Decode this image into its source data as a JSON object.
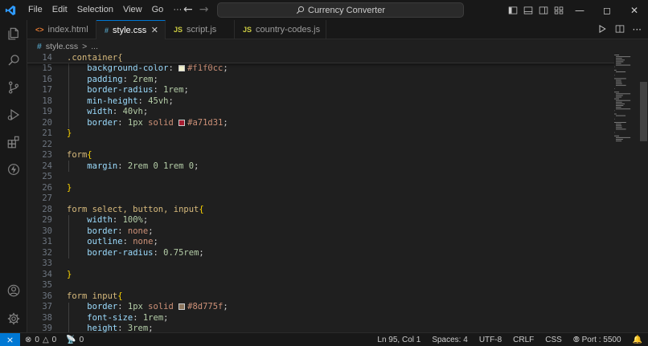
{
  "menu": [
    "File",
    "Edit",
    "Selection",
    "View",
    "Go",
    "···"
  ],
  "search": {
    "label": "Currency Converter"
  },
  "tabs": [
    {
      "label": "index.html",
      "icon": "<>",
      "color": "#e37933"
    },
    {
      "label": "style.css",
      "icon": "#",
      "color": "#519aba"
    },
    {
      "label": "script.js",
      "icon": "JS",
      "color": "#cbcb41"
    },
    {
      "label": "country-codes.js",
      "icon": "JS",
      "color": "#cbcb41"
    }
  ],
  "breadcrumb": {
    "icon": "#",
    "file": "style.css",
    "separator": ">",
    "more": "..."
  },
  "sticky": {
    "number": "14",
    "text": ".container{"
  },
  "code_lines": [
    {
      "n": "15",
      "tokens": [
        {
          "t": "    ",
          "c": ""
        },
        {
          "t": "background-color",
          "c": "prop"
        },
        {
          "t": ": ",
          "c": ""
        },
        {
          "swatch": "#f1f0cc"
        },
        {
          "t": "#f1f0cc",
          "c": "val"
        },
        {
          "t": ";",
          "c": ""
        }
      ]
    },
    {
      "n": "16",
      "tokens": [
        {
          "t": "    ",
          "c": ""
        },
        {
          "t": "padding",
          "c": "prop"
        },
        {
          "t": ": ",
          "c": ""
        },
        {
          "t": "2rem",
          "c": "num"
        },
        {
          "t": ";",
          "c": ""
        }
      ]
    },
    {
      "n": "17",
      "tokens": [
        {
          "t": "    ",
          "c": ""
        },
        {
          "t": "border-radius",
          "c": "prop"
        },
        {
          "t": ": ",
          "c": ""
        },
        {
          "t": "1rem",
          "c": "num"
        },
        {
          "t": ";",
          "c": ""
        }
      ]
    },
    {
      "n": "18",
      "tokens": [
        {
          "t": "    ",
          "c": ""
        },
        {
          "t": "min-height",
          "c": "prop"
        },
        {
          "t": ": ",
          "c": ""
        },
        {
          "t": "45vh",
          "c": "num"
        },
        {
          "t": ";",
          "c": ""
        }
      ]
    },
    {
      "n": "19",
      "tokens": [
        {
          "t": "    ",
          "c": ""
        },
        {
          "t": "width",
          "c": "prop"
        },
        {
          "t": ": ",
          "c": ""
        },
        {
          "t": "40vh",
          "c": "num"
        },
        {
          "t": ";",
          "c": ""
        }
      ]
    },
    {
      "n": "20",
      "tokens": [
        {
          "t": "    ",
          "c": ""
        },
        {
          "t": "border",
          "c": "prop"
        },
        {
          "t": ": ",
          "c": ""
        },
        {
          "t": "1px",
          "c": "num"
        },
        {
          "t": " solid ",
          "c": "val"
        },
        {
          "swatch": "#a71d31"
        },
        {
          "t": "#a71d31",
          "c": "val"
        },
        {
          "t": ";",
          "c": ""
        }
      ]
    },
    {
      "n": "21",
      "tokens": [
        {
          "t": "}",
          "c": "brace"
        }
      ]
    },
    {
      "n": "22",
      "tokens": []
    },
    {
      "n": "23",
      "tokens": [
        {
          "t": "form",
          "c": "sel"
        },
        {
          "t": "{",
          "c": "brace"
        }
      ]
    },
    {
      "n": "24",
      "tokens": [
        {
          "t": "    ",
          "c": ""
        },
        {
          "t": "margin",
          "c": "prop"
        },
        {
          "t": ": ",
          "c": ""
        },
        {
          "t": "2rem",
          "c": "num"
        },
        {
          "t": " ",
          "c": ""
        },
        {
          "t": "0",
          "c": "num"
        },
        {
          "t": " ",
          "c": ""
        },
        {
          "t": "1rem",
          "c": "num"
        },
        {
          "t": " ",
          "c": ""
        },
        {
          "t": "0",
          "c": "num"
        },
        {
          "t": ";",
          "c": ""
        }
      ]
    },
    {
      "n": "25",
      "tokens": []
    },
    {
      "n": "26",
      "tokens": [
        {
          "t": "}",
          "c": "brace"
        }
      ]
    },
    {
      "n": "27",
      "tokens": []
    },
    {
      "n": "28",
      "tokens": [
        {
          "t": "form select, button, input",
          "c": "sel"
        },
        {
          "t": "{",
          "c": "brace"
        }
      ]
    },
    {
      "n": "29",
      "tokens": [
        {
          "t": "    ",
          "c": ""
        },
        {
          "t": "width",
          "c": "prop"
        },
        {
          "t": ": ",
          "c": ""
        },
        {
          "t": "100%",
          "c": "num"
        },
        {
          "t": ";",
          "c": ""
        }
      ]
    },
    {
      "n": "30",
      "tokens": [
        {
          "t": "    ",
          "c": ""
        },
        {
          "t": "border",
          "c": "prop"
        },
        {
          "t": ": ",
          "c": ""
        },
        {
          "t": "none",
          "c": "val"
        },
        {
          "t": ";",
          "c": ""
        }
      ]
    },
    {
      "n": "31",
      "tokens": [
        {
          "t": "    ",
          "c": ""
        },
        {
          "t": "outline",
          "c": "prop"
        },
        {
          "t": ": ",
          "c": ""
        },
        {
          "t": "none",
          "c": "val"
        },
        {
          "t": ";",
          "c": ""
        }
      ]
    },
    {
      "n": "32",
      "tokens": [
        {
          "t": "    ",
          "c": ""
        },
        {
          "t": "border-radius",
          "c": "prop"
        },
        {
          "t": ": ",
          "c": ""
        },
        {
          "t": "0.75rem",
          "c": "num"
        },
        {
          "t": ";",
          "c": ""
        }
      ]
    },
    {
      "n": "33",
      "tokens": []
    },
    {
      "n": "34",
      "tokens": [
        {
          "t": "}",
          "c": "brace"
        }
      ]
    },
    {
      "n": "35",
      "tokens": []
    },
    {
      "n": "36",
      "tokens": [
        {
          "t": "form input",
          "c": "sel"
        },
        {
          "t": "{",
          "c": "brace"
        }
      ]
    },
    {
      "n": "37",
      "tokens": [
        {
          "t": "    ",
          "c": ""
        },
        {
          "t": "border",
          "c": "prop"
        },
        {
          "t": ": ",
          "c": ""
        },
        {
          "t": "1px",
          "c": "num"
        },
        {
          "t": " solid ",
          "c": "val"
        },
        {
          "swatch": "#8d775f"
        },
        {
          "t": "#8d775f",
          "c": "val"
        },
        {
          "t": ";",
          "c": ""
        }
      ]
    },
    {
      "n": "38",
      "tokens": [
        {
          "t": "    ",
          "c": ""
        },
        {
          "t": "font-size",
          "c": "prop"
        },
        {
          "t": ": ",
          "c": ""
        },
        {
          "t": "1rem",
          "c": "num"
        },
        {
          "t": ";",
          "c": ""
        }
      ]
    },
    {
      "n": "39",
      "tokens": [
        {
          "t": "    ",
          "c": ""
        },
        {
          "t": "height",
          "c": "prop"
        },
        {
          "t": ": ",
          "c": ""
        },
        {
          "t": "3rem",
          "c": "num"
        },
        {
          "t": ";",
          "c": ""
        }
      ]
    }
  ],
  "status": {
    "errors": "0",
    "warnings": "0",
    "ports_forwarded": "0",
    "cursor": "Ln 95, Col 1",
    "spaces": "Spaces: 4",
    "encoding": "UTF-8",
    "eol": "CRLF",
    "language": "CSS",
    "port": "Port : 5500"
  },
  "colors": {
    "accent": "#0078d4",
    "background": "#1f1f1f",
    "chrome": "#181818"
  }
}
